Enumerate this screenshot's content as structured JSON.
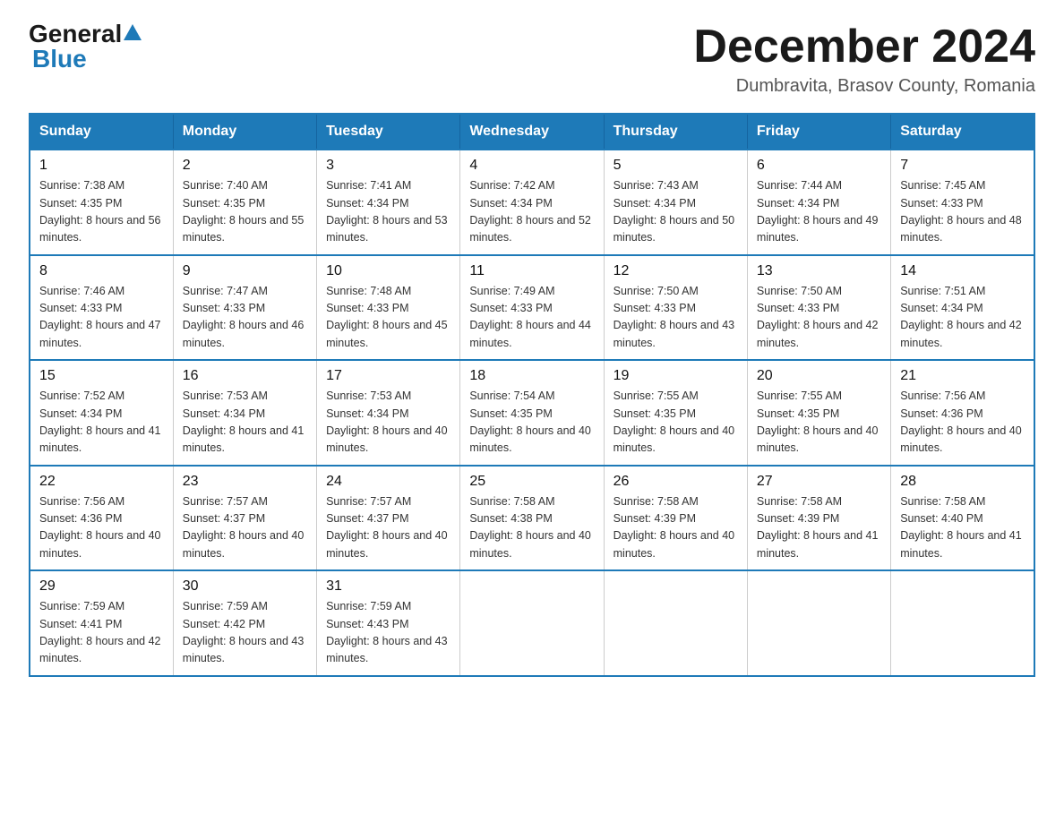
{
  "header": {
    "logo_general": "General",
    "logo_blue": "Blue",
    "month_title": "December 2024",
    "location": "Dumbravita, Brasov County, Romania"
  },
  "weekdays": [
    "Sunday",
    "Monday",
    "Tuesday",
    "Wednesday",
    "Thursday",
    "Friday",
    "Saturday"
  ],
  "weeks": [
    [
      {
        "day": "1",
        "sunrise": "7:38 AM",
        "sunset": "4:35 PM",
        "daylight": "8 hours and 56 minutes."
      },
      {
        "day": "2",
        "sunrise": "7:40 AM",
        "sunset": "4:35 PM",
        "daylight": "8 hours and 55 minutes."
      },
      {
        "day": "3",
        "sunrise": "7:41 AM",
        "sunset": "4:34 PM",
        "daylight": "8 hours and 53 minutes."
      },
      {
        "day": "4",
        "sunrise": "7:42 AM",
        "sunset": "4:34 PM",
        "daylight": "8 hours and 52 minutes."
      },
      {
        "day": "5",
        "sunrise": "7:43 AM",
        "sunset": "4:34 PM",
        "daylight": "8 hours and 50 minutes."
      },
      {
        "day": "6",
        "sunrise": "7:44 AM",
        "sunset": "4:34 PM",
        "daylight": "8 hours and 49 minutes."
      },
      {
        "day": "7",
        "sunrise": "7:45 AM",
        "sunset": "4:33 PM",
        "daylight": "8 hours and 48 minutes."
      }
    ],
    [
      {
        "day": "8",
        "sunrise": "7:46 AM",
        "sunset": "4:33 PM",
        "daylight": "8 hours and 47 minutes."
      },
      {
        "day": "9",
        "sunrise": "7:47 AM",
        "sunset": "4:33 PM",
        "daylight": "8 hours and 46 minutes."
      },
      {
        "day": "10",
        "sunrise": "7:48 AM",
        "sunset": "4:33 PM",
        "daylight": "8 hours and 45 minutes."
      },
      {
        "day": "11",
        "sunrise": "7:49 AM",
        "sunset": "4:33 PM",
        "daylight": "8 hours and 44 minutes."
      },
      {
        "day": "12",
        "sunrise": "7:50 AM",
        "sunset": "4:33 PM",
        "daylight": "8 hours and 43 minutes."
      },
      {
        "day": "13",
        "sunrise": "7:50 AM",
        "sunset": "4:33 PM",
        "daylight": "8 hours and 42 minutes."
      },
      {
        "day": "14",
        "sunrise": "7:51 AM",
        "sunset": "4:34 PM",
        "daylight": "8 hours and 42 minutes."
      }
    ],
    [
      {
        "day": "15",
        "sunrise": "7:52 AM",
        "sunset": "4:34 PM",
        "daylight": "8 hours and 41 minutes."
      },
      {
        "day": "16",
        "sunrise": "7:53 AM",
        "sunset": "4:34 PM",
        "daylight": "8 hours and 41 minutes."
      },
      {
        "day": "17",
        "sunrise": "7:53 AM",
        "sunset": "4:34 PM",
        "daylight": "8 hours and 40 minutes."
      },
      {
        "day": "18",
        "sunrise": "7:54 AM",
        "sunset": "4:35 PM",
        "daylight": "8 hours and 40 minutes."
      },
      {
        "day": "19",
        "sunrise": "7:55 AM",
        "sunset": "4:35 PM",
        "daylight": "8 hours and 40 minutes."
      },
      {
        "day": "20",
        "sunrise": "7:55 AM",
        "sunset": "4:35 PM",
        "daylight": "8 hours and 40 minutes."
      },
      {
        "day": "21",
        "sunrise": "7:56 AM",
        "sunset": "4:36 PM",
        "daylight": "8 hours and 40 minutes."
      }
    ],
    [
      {
        "day": "22",
        "sunrise": "7:56 AM",
        "sunset": "4:36 PM",
        "daylight": "8 hours and 40 minutes."
      },
      {
        "day": "23",
        "sunrise": "7:57 AM",
        "sunset": "4:37 PM",
        "daylight": "8 hours and 40 minutes."
      },
      {
        "day": "24",
        "sunrise": "7:57 AM",
        "sunset": "4:37 PM",
        "daylight": "8 hours and 40 minutes."
      },
      {
        "day": "25",
        "sunrise": "7:58 AM",
        "sunset": "4:38 PM",
        "daylight": "8 hours and 40 minutes."
      },
      {
        "day": "26",
        "sunrise": "7:58 AM",
        "sunset": "4:39 PM",
        "daylight": "8 hours and 40 minutes."
      },
      {
        "day": "27",
        "sunrise": "7:58 AM",
        "sunset": "4:39 PM",
        "daylight": "8 hours and 41 minutes."
      },
      {
        "day": "28",
        "sunrise": "7:58 AM",
        "sunset": "4:40 PM",
        "daylight": "8 hours and 41 minutes."
      }
    ],
    [
      {
        "day": "29",
        "sunrise": "7:59 AM",
        "sunset": "4:41 PM",
        "daylight": "8 hours and 42 minutes."
      },
      {
        "day": "30",
        "sunrise": "7:59 AM",
        "sunset": "4:42 PM",
        "daylight": "8 hours and 43 minutes."
      },
      {
        "day": "31",
        "sunrise": "7:59 AM",
        "sunset": "4:43 PM",
        "daylight": "8 hours and 43 minutes."
      },
      null,
      null,
      null,
      null
    ]
  ],
  "labels": {
    "sunrise": "Sunrise: ",
    "sunset": "Sunset: ",
    "daylight": "Daylight: "
  }
}
